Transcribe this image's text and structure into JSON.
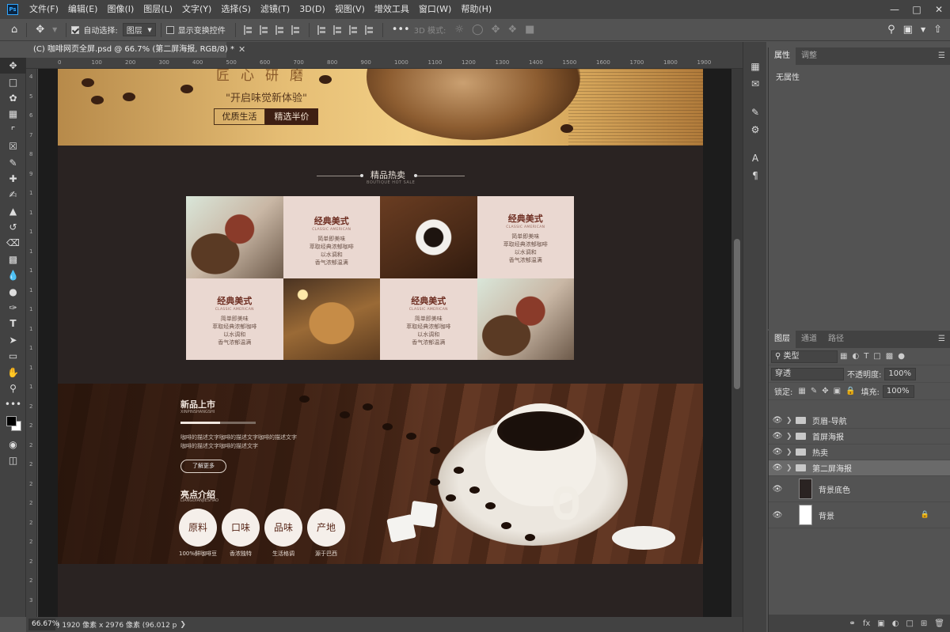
{
  "app": {
    "menus": [
      "文件(F)",
      "编辑(E)",
      "图像(I)",
      "图层(L)",
      "文字(Y)",
      "选择(S)",
      "滤镜(T)",
      "3D(D)",
      "视图(V)",
      "增效工具",
      "窗口(W)",
      "帮助(H)"
    ]
  },
  "options": {
    "auto_select_label": "自动选择:",
    "auto_select_target": "图层",
    "show_transform_label": "显示变换控件",
    "mode_3d_label": "3D 模式:"
  },
  "document": {
    "tab_title": "(C) 咖啡网页全屏.psd @ 66.7% (第二屏海报, RGB/8) *",
    "ruler_h_ticks": [
      "0",
      "100",
      "200",
      "300",
      "400",
      "500",
      "600",
      "700",
      "800",
      "900",
      "1000",
      "1100",
      "1200",
      "1300",
      "1400",
      "1500",
      "1600",
      "1700",
      "1800",
      "1900"
    ],
    "ruler_v_ticks": [
      "4",
      "5",
      "6",
      "7",
      "8",
      "9",
      "1",
      "1",
      "1",
      "1",
      "1",
      "1",
      "1",
      "1",
      "1",
      "1",
      "1",
      "2",
      "2",
      "2",
      "2",
      "2",
      "2",
      "2",
      "2",
      "2",
      "2",
      "3"
    ]
  },
  "canvas": {
    "hero_chars": "匠心研磨",
    "hero_slogan": "\"开启味觉新体验\"",
    "hero_btn1": "优质生活",
    "hero_btn2": "精选半价",
    "hot_title": "精品热卖",
    "hot_sub": "BOUTIQUE HOT SALE",
    "product_title": "经典美式",
    "product_sub": "CLASSIC AMERICAN",
    "product_lines": [
      "简单即美味",
      "萃取经典浓郁咖啡",
      "以水调和",
      "香气浓郁温满"
    ],
    "new_title": "新品上市",
    "new_pinyin": "XINPINSHANGSHI",
    "new_desc": [
      "咖啡的描述文字咖啡的描述文字咖啡的描述文字",
      "咖啡的描述文字咖啡的描述文字"
    ],
    "learn_more": "了解更多",
    "highlight_title": "亮点介绍",
    "highlight_pinyin": "LIANGDIANJIESHAO",
    "features": [
      {
        "label": "原料",
        "caption": "100%鲜咖啡豆"
      },
      {
        "label": "口味",
        "caption": "香浓独特"
      },
      {
        "label": "品味",
        "caption": "生活格调"
      },
      {
        "label": "产地",
        "caption": "源于巴西"
      }
    ]
  },
  "status": {
    "zoom": "66.67%",
    "doc_info": ") 1920 像素 x 2976 像素 (96.012 p"
  },
  "properties": {
    "tabs": [
      "属性",
      "调整"
    ],
    "content": "无属性"
  },
  "layers": {
    "tabs": [
      "图层",
      "通道",
      "路径"
    ],
    "filter_kind": "类型",
    "blend_mode": "穿透",
    "opacity_label": "不透明度:",
    "opacity_value": "100%",
    "lock_label": "锁定:",
    "fill_label": "填充:",
    "fill_value": "100%",
    "items": [
      {
        "name": "页眉-导航",
        "type": "group"
      },
      {
        "name": "首屏海报",
        "type": "group"
      },
      {
        "name": "热卖",
        "type": "group"
      },
      {
        "name": "第二屏海报",
        "type": "group",
        "selected": true
      },
      {
        "name": "背景底色",
        "type": "layer"
      },
      {
        "name": "背景",
        "type": "background",
        "locked": true
      }
    ]
  }
}
